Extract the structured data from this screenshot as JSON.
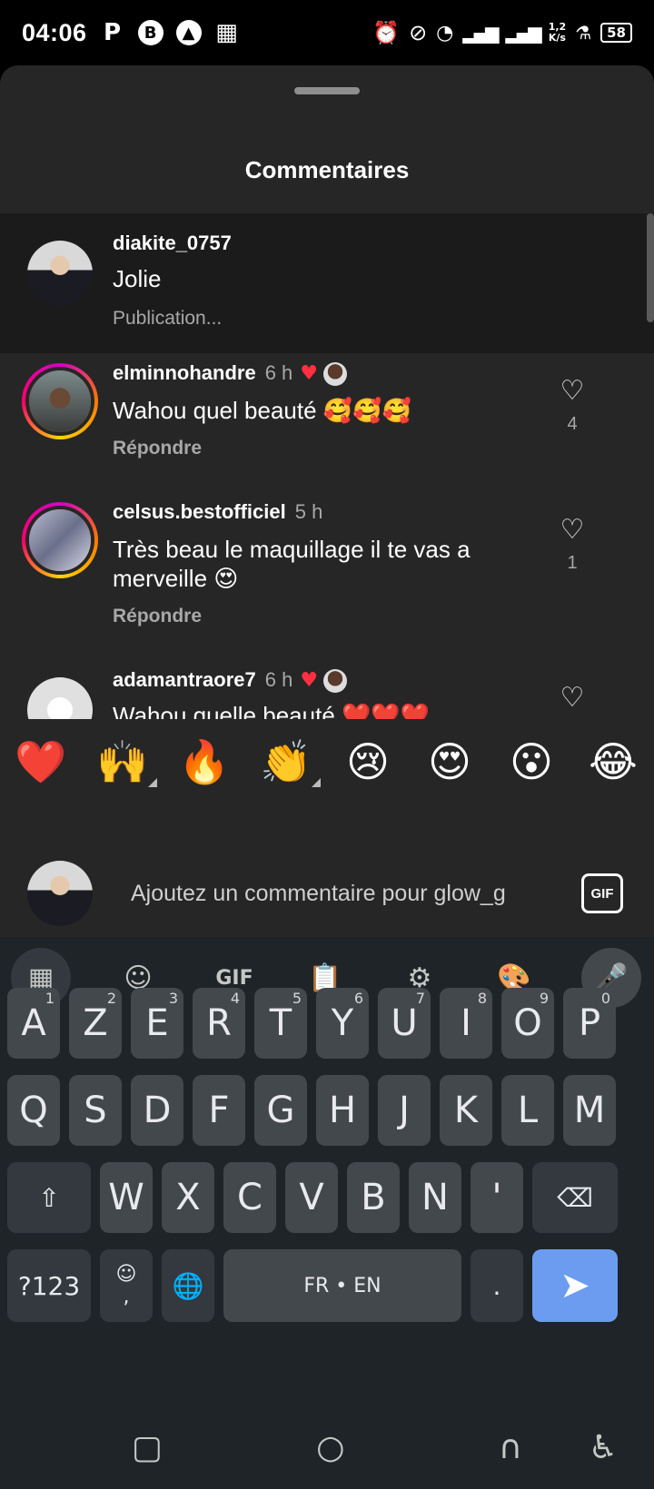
{
  "status_bar": {
    "time": "04:06",
    "speed_value": "1,2",
    "speed_unit": "K/s",
    "battery": "58"
  },
  "sheet": {
    "title": "Commentaires"
  },
  "caption": {
    "username": "diakite_0757",
    "text": "Jolie",
    "meta": "Publication..."
  },
  "comments": [
    {
      "username": "elminnohandre",
      "time": "6 h",
      "text": "Wahou quel beauté 🥰🥰🥰",
      "reply": "Répondre",
      "likes": "4"
    },
    {
      "username": "celsus.bestofficiel",
      "time": "5 h",
      "text": "Très beau le maquillage il te vas a merveille 😍",
      "reply": "Répondre",
      "likes": "1"
    },
    {
      "username": "adamantraore7",
      "time": "6 h",
      "text": "Wahou quelle beauté ❤️❤️❤️",
      "reply": "",
      "likes": ""
    }
  ],
  "emoji_bar": [
    "❤️",
    "🙌",
    "🔥",
    "👏",
    "😢",
    "😍",
    "😮",
    "😂"
  ],
  "composer": {
    "placeholder": "Ajoutez un commentaire pour glow_g",
    "gif_label": "GIF"
  },
  "keyboard": {
    "toolbar_gif": "GIF",
    "row1": [
      {
        "k": "A",
        "h": "1"
      },
      {
        "k": "Z",
        "h": "2"
      },
      {
        "k": "E",
        "h": "3"
      },
      {
        "k": "R",
        "h": "4"
      },
      {
        "k": "T",
        "h": "5"
      },
      {
        "k": "Y",
        "h": "6"
      },
      {
        "k": "U",
        "h": "7"
      },
      {
        "k": "I",
        "h": "8"
      },
      {
        "k": "O",
        "h": "9"
      },
      {
        "k": "P",
        "h": "0"
      }
    ],
    "row2": [
      "Q",
      "S",
      "D",
      "F",
      "G",
      "H",
      "J",
      "K",
      "L",
      "M"
    ],
    "row3": [
      "W",
      "X",
      "C",
      "V",
      "B",
      "N",
      "'"
    ],
    "symbols": "?123",
    "comma": ",",
    "space": "FR • EN",
    "period": "."
  }
}
